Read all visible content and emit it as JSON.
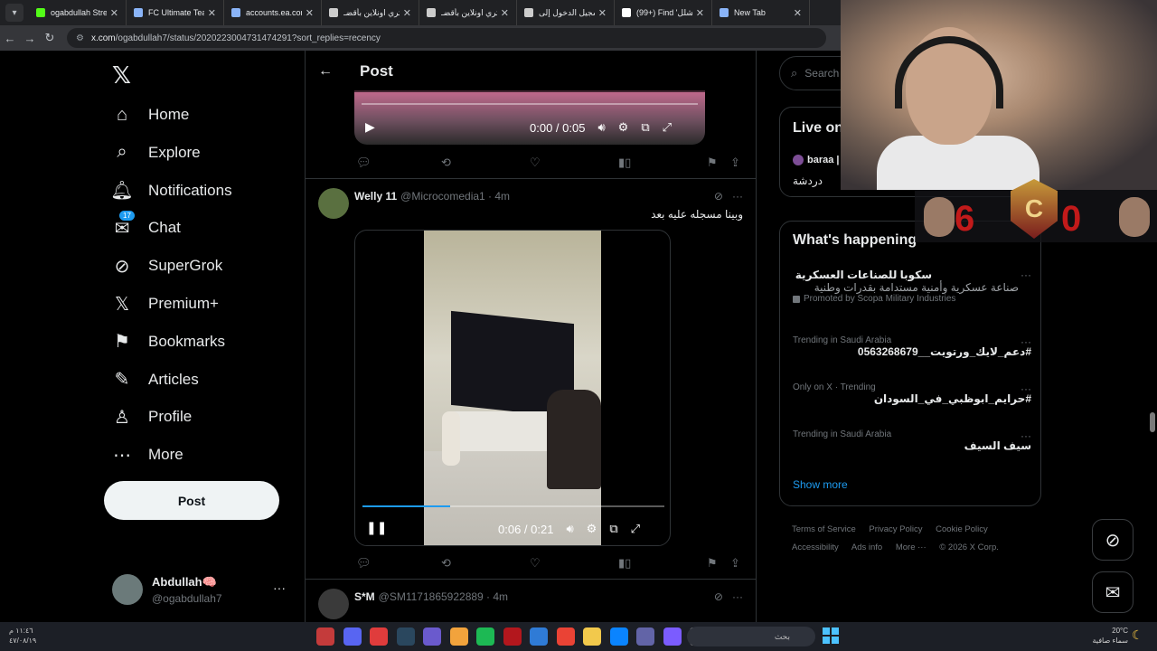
{
  "browser": {
    "tabs": [
      {
        "label": "ogabdullah Stream",
        "color": "#53fc18"
      },
      {
        "label": "FC Ultimate Team",
        "color": "#8ab4f8"
      },
      {
        "label": "accounts.ea.com",
        "color": "#8ab4f8"
      },
      {
        "label": "اشتري اونلاين بأقضـ",
        "color": "#cccccc"
      },
      {
        "label": "اشتري اونلاين بأقضـ",
        "color": "#cccccc"
      },
      {
        "label": "تسجيل الدخول إلى",
        "color": "#cccccc"
      },
      {
        "label": "(99+) Find 'التشلل'",
        "color": "#ffffff"
      },
      {
        "label": "New Tab",
        "color": "#8ab4f8"
      }
    ],
    "url_host": "x.com",
    "url_path": "/ogabdullah7/status/2020223004731474291?sort_replies=recency"
  },
  "nav": {
    "items": [
      {
        "label": "Home",
        "icon": "home-icon"
      },
      {
        "label": "Explore",
        "icon": "search-icon"
      },
      {
        "label": "Notifications",
        "icon": "bell-icon"
      },
      {
        "label": "Chat",
        "icon": "mail-icon",
        "badge": "17"
      },
      {
        "label": "SuperGrok",
        "icon": "grok-icon"
      },
      {
        "label": "Premium+",
        "icon": "x-icon"
      },
      {
        "label": "Bookmarks",
        "icon": "bookmark-icon"
      },
      {
        "label": "Articles",
        "icon": "articles-icon"
      },
      {
        "label": "Profile",
        "icon": "person-icon"
      },
      {
        "label": "More",
        "icon": "more-circle-icon"
      }
    ],
    "post_label": "Post",
    "account": {
      "name": "Abdullah🧠",
      "handle": "@ogabdullah7"
    }
  },
  "main": {
    "title": "Post",
    "video1_time": "0:00 / 0:05",
    "reply1": {
      "name": "Welly 11",
      "handle": "@Microcomedia1 · 4m",
      "text": "وبينا مسجله عليه بعد",
      "video_time": "0:06 / 0:21",
      "progress": 0.29
    },
    "reply2": {
      "name": "S*M",
      "handle": "@SM1171865922889 · 4m"
    }
  },
  "right": {
    "search_placeholder": "Search",
    "live_title": "Live on X",
    "live_host": "baraa |",
    "live_desc": "دردشة",
    "trends_title": "What's happening",
    "trends": [
      {
        "meta": "",
        "title": "سكوبا للصناعات العسكرية",
        "sub": "صناعة عسكرية وأمنية مستدامة بقدرات وطنية",
        "promo": "Promoted by Scopa Military Industries"
      },
      {
        "meta": "Trending in Saudi Arabia",
        "title": "#دعم_لايك_ورتويت__0563268679"
      },
      {
        "meta": "Only on X · Trending",
        "title": "#حرايم_ابوظبي_في_السودان"
      },
      {
        "meta": "Trending in Saudi Arabia",
        "title": "سيف السيف"
      }
    ],
    "show_more": "Show more",
    "footer": [
      "Terms of Service",
      "Privacy Policy",
      "Cookie Policy",
      "Accessibility",
      "Ads info",
      "More ···",
      "© 2026 X Corp."
    ]
  },
  "overlay": {
    "score_left": "6",
    "score_right": "0",
    "crest": "C"
  },
  "taskbar": {
    "time": "١١:٤٦ م",
    "date": "٤٧/٠٨/١٩",
    "search": "بحث",
    "temp": "20°C",
    "weather": "سماء صافية"
  }
}
